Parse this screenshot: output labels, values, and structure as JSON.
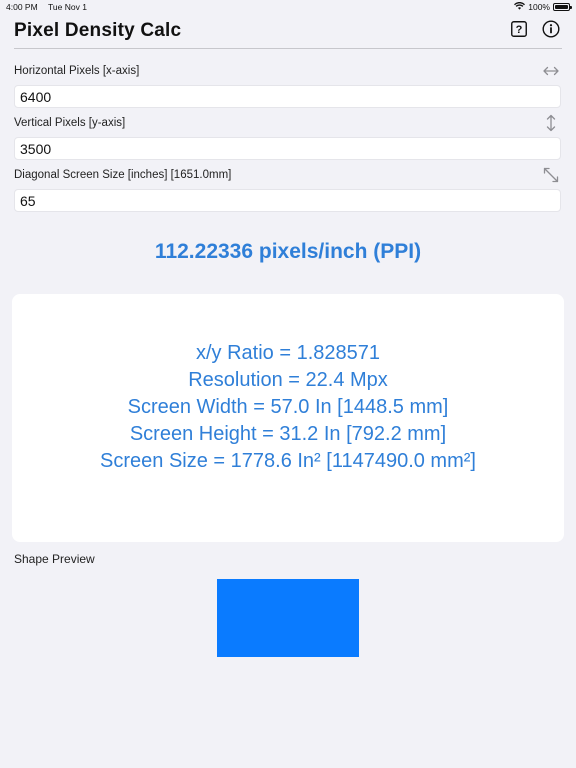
{
  "status": {
    "time": "4:00 PM",
    "date": "Tue Nov 1",
    "battery_text": "100%",
    "battery_level": 1.0
  },
  "header": {
    "title": "Pixel Density Calc",
    "help_icon": "question-mark-square-icon",
    "info_icon": "info-circle-icon"
  },
  "fields": {
    "horizontal": {
      "label": "Horizontal Pixels  [x-axis]",
      "value": "6400",
      "icon": "horizontal-arrows-icon"
    },
    "vertical": {
      "label": "Vertical Pixels [y-axis]",
      "value": "3500",
      "icon": "vertical-arrows-icon"
    },
    "diagonal": {
      "label": "Diagonal Screen Size [inches] [1651.0mm]",
      "value": "65",
      "icon": "diagonal-arrows-icon"
    }
  },
  "result": {
    "ppi": "112.22336 pixels/inch (PPI)",
    "lines": [
      "x/y Ratio = 1.828571",
      "Resolution = 22.4 Mpx",
      "Screen Width = 57.0 In [1448.5 mm]",
      "Screen Height = 31.2 In [792.2 mm]",
      "Screen Size = 1778.6 In² [1147490.0 mm²]"
    ]
  },
  "preview": {
    "label": "Shape Preview",
    "aspect_ratio": 1.828571,
    "color": "#0a7bff"
  },
  "colors": {
    "accent": "#2f7fd8",
    "background": "#f2f2f7",
    "card": "#ffffff"
  }
}
